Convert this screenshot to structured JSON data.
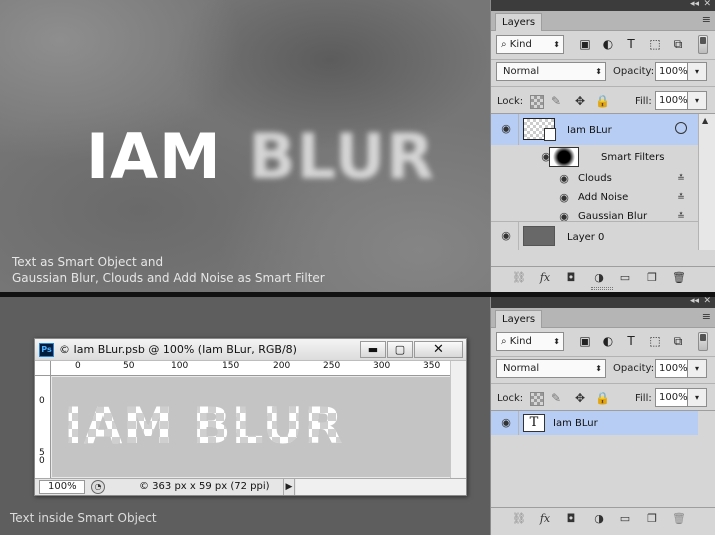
{
  "top": {
    "text_sharp": "IAM ",
    "text_blur": "BLUR",
    "caption_line1": "Text as Smart Object and",
    "caption_line2": "Gaussian Blur, Clouds and Add Noise as Smart Filter"
  },
  "bottom": {
    "caption": "Text inside Smart Object"
  },
  "doc_window": {
    "title": "© Iam BLur.psb @ 100% (Iam BLur, RGB/8)",
    "ps_badge": "Ps",
    "minimize": "▬",
    "maximize": "▢",
    "close": "✕",
    "content_text": "IAM BLUR",
    "ruler_h_labels": [
      "0",
      "50",
      "100",
      "150",
      "200",
      "250",
      "300",
      "350"
    ],
    "ruler_v_labels": [
      "0",
      "5",
      "0"
    ],
    "zoom": "100%",
    "info": "© 363 px x 59 px (72 ppi)",
    "status_arrow": "▶"
  },
  "panel_top": {
    "tab": "Layers",
    "kind_label": "Kind",
    "blend_mode": "Normal",
    "opacity_label": "Opacity:",
    "opacity_value": "100%",
    "lock_label": "Lock:",
    "fill_label": "Fill:",
    "fill_value": "100%",
    "layers": [
      {
        "name": "Iam BLur"
      },
      {
        "name": "Smart Filters"
      },
      {
        "name": "Clouds"
      },
      {
        "name": "Add Noise"
      },
      {
        "name": "Gaussian Blur"
      },
      {
        "name": "Layer 0"
      }
    ]
  },
  "panel_bottom": {
    "tab": "Layers",
    "kind_label": "Kind",
    "blend_mode": "Normal",
    "opacity_label": "Opacity:",
    "opacity_value": "100%",
    "lock_label": "Lock:",
    "fill_label": "Fill:",
    "fill_value": "100%",
    "layers": [
      {
        "name": "Iam BLur",
        "thumb": "T"
      }
    ]
  },
  "icons": {
    "collapse": "◂◂",
    "close": "✕",
    "menu": "≡",
    "search": "⌕",
    "image": "▣",
    "adjust": "◐",
    "type": "T",
    "shape": "⬚",
    "smart": "⧉",
    "dropdown": "▾",
    "spinner": "⬍",
    "brush": "✎",
    "move": "✥",
    "lock": "🔒",
    "eye": "◉",
    "settings": "≛",
    "link": "⛓",
    "fx": "fx",
    "mask": "◘",
    "adjustment": "◑",
    "folder": "▭",
    "new": "❐",
    "trash": "🗑",
    "scroll_up": "▲"
  }
}
